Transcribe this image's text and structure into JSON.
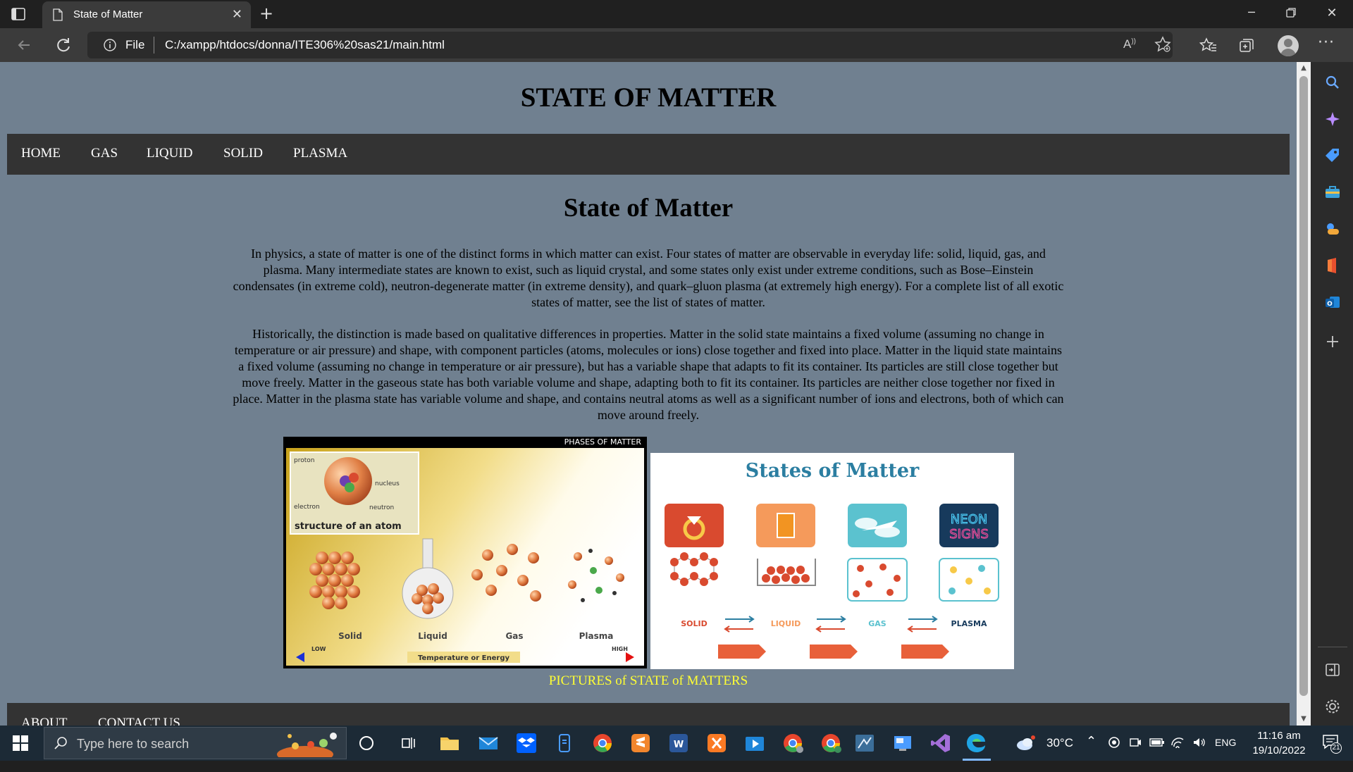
{
  "browser": {
    "tab_title": "State of Matter",
    "file_label": "File",
    "url": "C:/xampp/htdocs/donna/ITE306%20sas21/main.html",
    "read_aloud": "A̅",
    "icons": [
      "tab-actions-icon",
      "page-icon",
      "close-icon",
      "plus-icon",
      "minimize-icon",
      "restore-icon",
      "close-window-icon",
      "back-icon",
      "refresh-icon",
      "info-icon",
      "read-aloud-icon",
      "add-favorite-icon",
      "favorites-icon",
      "collections-icon",
      "profile-icon",
      "more-icon"
    ]
  },
  "page": {
    "heading": "STATE OF MATTER",
    "nav": [
      "HOME",
      "GAS",
      "LIQUID",
      "SOLID",
      "PLASMA"
    ],
    "subheading": "State of Matter",
    "paragraph1": "In physics, a state of matter is one of the distinct forms in which matter can exist. Four states of matter are observable in everyday life: solid, liquid, gas, and plasma. Many intermediate states are known to exist, such as liquid crystal, and some states only exist under extreme conditions, such as Bose–Einstein condensates (in extreme cold), neutron-degenerate matter (in extreme density), and quark–gluon plasma (at extremely high energy). For a complete list of all exotic states of matter, see the list of states of matter.",
    "paragraph2": "Historically, the distinction is made based on qualitative differences in properties. Matter in the solid state maintains a fixed volume (assuming no change in temperature or air pressure) and shape, with component particles (atoms, molecules or ions) close together and fixed into place. Matter in the liquid state maintains a fixed volume (assuming no change in temperature or air pressure), but has a variable shape that adapts to fit its container. Its particles are still close together but move freely. Matter in the gaseous state has both variable volume and shape, adapting both to fit its container. Its particles are neither close together nor fixed in place. Matter in the plasma state has variable volume and shape, and contains neutral atoms as well as a significant number of ions and electrons, both of which can move around freely.",
    "image1": {
      "banner": "PHASES OF MATTER",
      "atom_title": "structure of an atom",
      "labels": [
        "proton",
        "nucleus",
        "electron",
        "neutron"
      ],
      "phases": [
        "Solid",
        "Liquid",
        "Gas",
        "Plasma"
      ],
      "low": "LOW",
      "high": "HIGH",
      "axis": "Temperature or Energy"
    },
    "image2": {
      "title": "States of Matter",
      "states": [
        "SOLID",
        "LIQUID",
        "GAS",
        "PLASMA"
      ],
      "neon": "NEON",
      "signs": "SIGNS",
      "colors": {
        "title": "#2b7ea1",
        "solid": "#d94a2f",
        "liquid": "#f59a5b",
        "gas": "#5bc2cf",
        "plasma": "#173a5c"
      }
    },
    "caption": "PICTURES of STATE of MATTERS",
    "footer": [
      "ABOUT",
      "CONTACT US"
    ]
  },
  "sidebar": {
    "icons": [
      "search-icon",
      "copilot-icon",
      "tag-icon",
      "briefcase-icon",
      "games-icon",
      "office-icon",
      "outlook-icon",
      "add-icon",
      "split-screen-icon",
      "settings-icon"
    ]
  },
  "taskbar": {
    "search_placeholder": "Type here to search",
    "weather": "30°C",
    "language": "ENG",
    "time": "11:16 am",
    "date": "19/10/2022",
    "notifications": "21"
  }
}
